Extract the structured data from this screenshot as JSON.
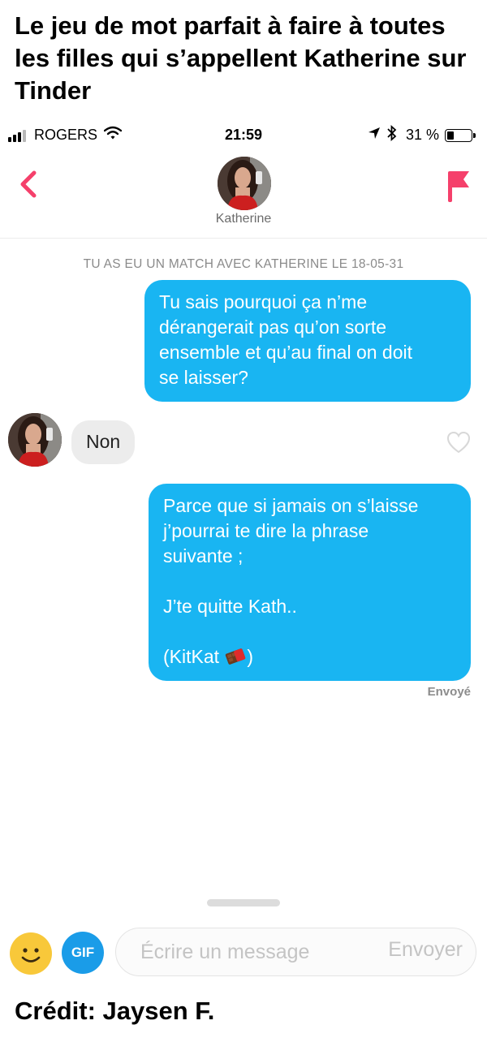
{
  "caption": "Le jeu de mot parfait à faire à toutes les filles qui s’appellent Katherine sur Tinder",
  "credit": "Crédit: Jaysen F.",
  "status_bar": {
    "carrier": "ROGERS",
    "time": "21:59",
    "battery_percent": "31 %",
    "battery_level": 0.31
  },
  "header": {
    "match_name": "Katherine"
  },
  "conversation": {
    "match_notice": "TU AS EU UN MATCH AVEC KATHERINE LE 18-05-31",
    "messages": [
      {
        "direction": "outgoing",
        "lines": [
          "Tu sais pourquoi ça n’me",
          "dérangerait pas qu’on sorte",
          "ensemble et qu’au final on doit",
          "se laisser?"
        ]
      },
      {
        "direction": "incoming",
        "text": "Non"
      },
      {
        "direction": "outgoing",
        "lines": [
          "Parce que si jamais on s’laisse",
          "j’pourrai te dire la phrase",
          "suivante ;",
          "",
          "J’te quitte Kath..",
          "",
          "(KitKat",
          ")"
        ],
        "status": "Envoyé"
      }
    ]
  },
  "composer": {
    "gif_label": "GIF",
    "placeholder": "Écrire un message",
    "send_label": "Envoyer"
  },
  "colors": {
    "outgoing_bubble": "#19b5f2",
    "incoming_bubble": "#ececec",
    "tinder_accent": "#f5406b",
    "gif_button": "#1a9ce8"
  },
  "icons": {
    "back": "chevron-left-icon",
    "report": "flag-icon",
    "like": "heart-icon",
    "emoji": "smiley-icon",
    "chocolate": "chocolate-bar-emoji"
  }
}
